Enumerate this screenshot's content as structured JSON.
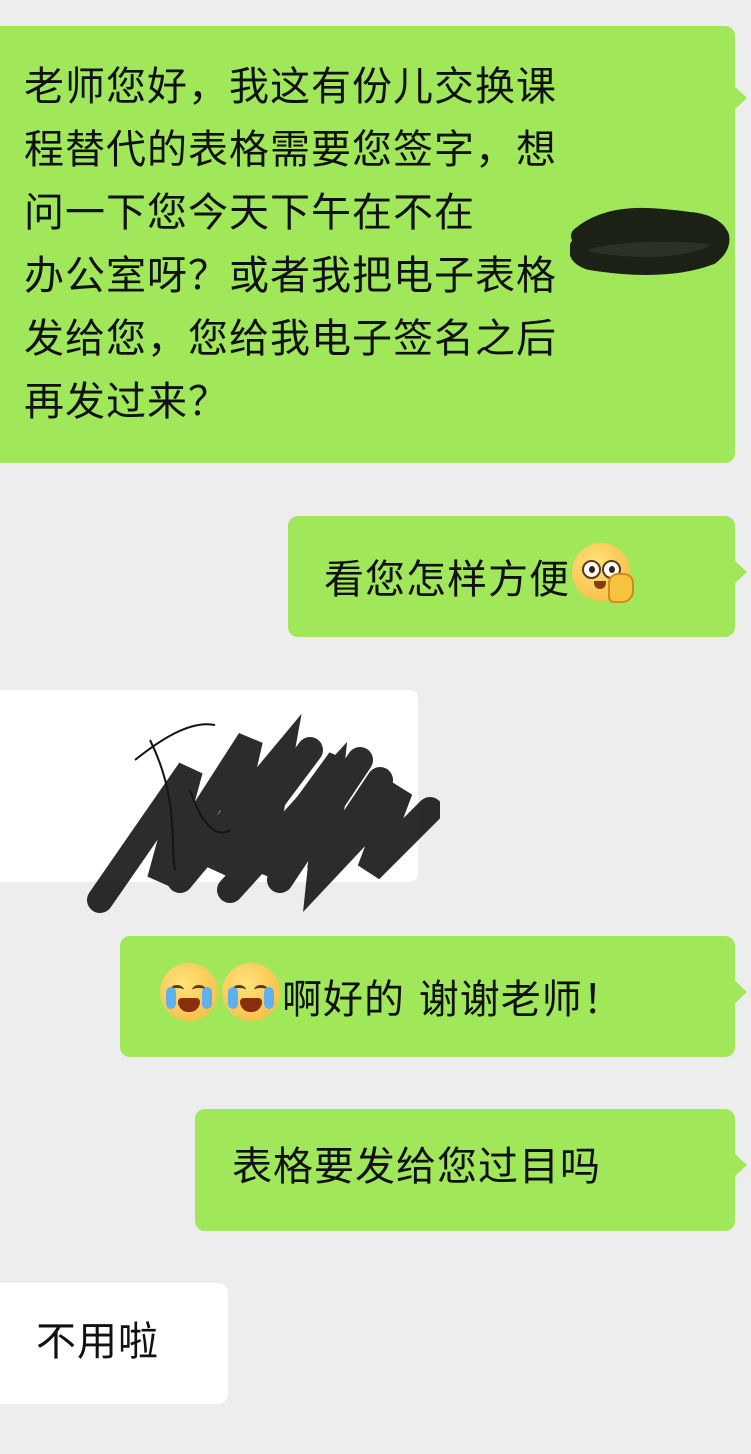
{
  "messages": [
    {
      "id": "m1",
      "direction": "sent",
      "text": "老师您好，我这有份儿交换课程替代的表格需要您签字，想问一下您今天下午在不在",
      "text_cont": "办公室呀？或者我把电子表格发给您，您给我电子签名之后再发过来？"
    },
    {
      "id": "m2",
      "direction": "sent",
      "text": "看您怎样方便",
      "emoji": "thinking-face-icon"
    },
    {
      "id": "m3",
      "direction": "received",
      "type": "image",
      "content": "handwritten-signature-image"
    },
    {
      "id": "m4",
      "direction": "sent",
      "text": "啊好的 谢谢老师！",
      "emoji": "crying-face-icon"
    },
    {
      "id": "m5",
      "direction": "sent",
      "text": "表格要发给您过目吗"
    },
    {
      "id": "m6",
      "direction": "received",
      "text": "不用啦"
    }
  ],
  "colors": {
    "background": "#ededed",
    "sent_bubble": "#a0e75a",
    "received_bubble": "#ffffff"
  }
}
